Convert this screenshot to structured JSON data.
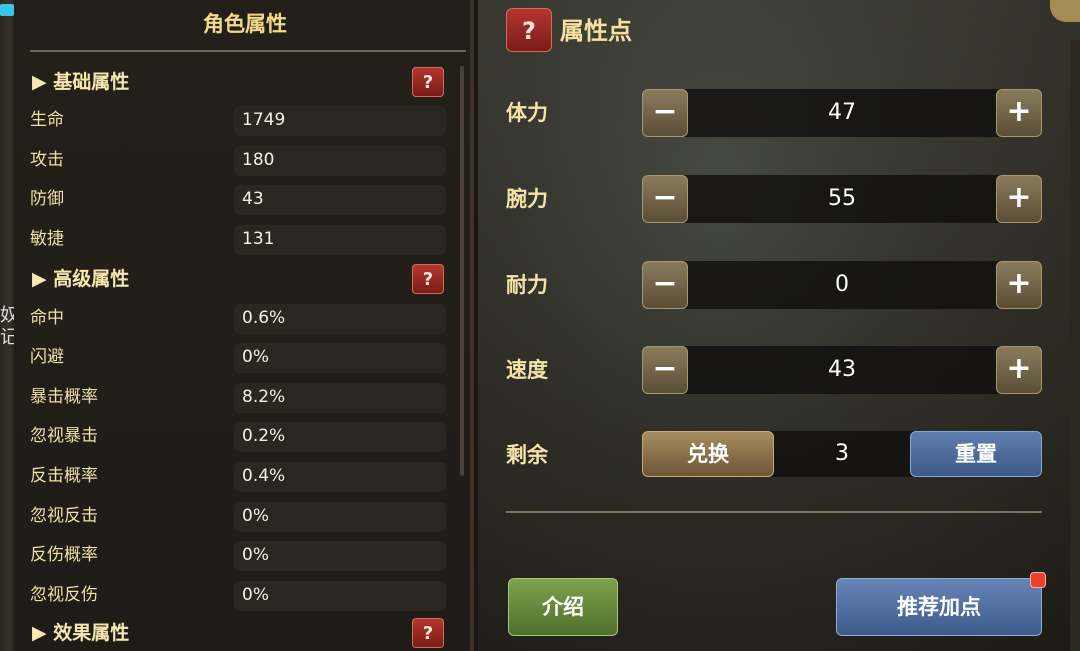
{
  "left_panel": {
    "title": "角色属性",
    "edge_text": "奴\n记",
    "sections": {
      "basic": {
        "label": "▶ 基础属性",
        "help": "?"
      },
      "advanced": {
        "label": "▶ 高级属性",
        "help": "?"
      },
      "effect": {
        "label": "▶ 效果属性",
        "help": "?"
      }
    },
    "basic_stats": [
      {
        "label": "生命",
        "value": "1749"
      },
      {
        "label": "攻击",
        "value": "180"
      },
      {
        "label": "防御",
        "value": "43"
      },
      {
        "label": "敏捷",
        "value": "131"
      }
    ],
    "advanced_stats": [
      {
        "label": "命中",
        "value": "0.6%"
      },
      {
        "label": "闪避",
        "value": "0%"
      },
      {
        "label": "暴击概率",
        "value": "8.2%"
      },
      {
        "label": "忽视暴击",
        "value": "0.2%"
      },
      {
        "label": "反击概率",
        "value": "0.4%"
      },
      {
        "label": "忽视反击",
        "value": "0%"
      },
      {
        "label": "反伤概率",
        "value": "0%"
      },
      {
        "label": "忽视反伤",
        "value": "0%"
      }
    ]
  },
  "right_panel": {
    "help": "?",
    "title": "属性点",
    "minus_symbol": "−",
    "plus_symbol": "+",
    "stats": [
      {
        "label": "体力",
        "value": "47"
      },
      {
        "label": "腕力",
        "value": "55"
      },
      {
        "label": "耐力",
        "value": "0"
      },
      {
        "label": "速度",
        "value": "43"
      }
    ],
    "remaining": {
      "label": "剩余",
      "value": "3",
      "exchange_label": "兑换",
      "reset_label": "重置"
    },
    "intro_label": "介绍",
    "recommend_label": "推荐加点"
  },
  "colors": {
    "gold_text": "#f5e4aa",
    "help_red": "#b3362e",
    "reset_blue": "#5f7fb0",
    "intro_green": "#7ea24e",
    "notify_red": "#e8432a"
  }
}
